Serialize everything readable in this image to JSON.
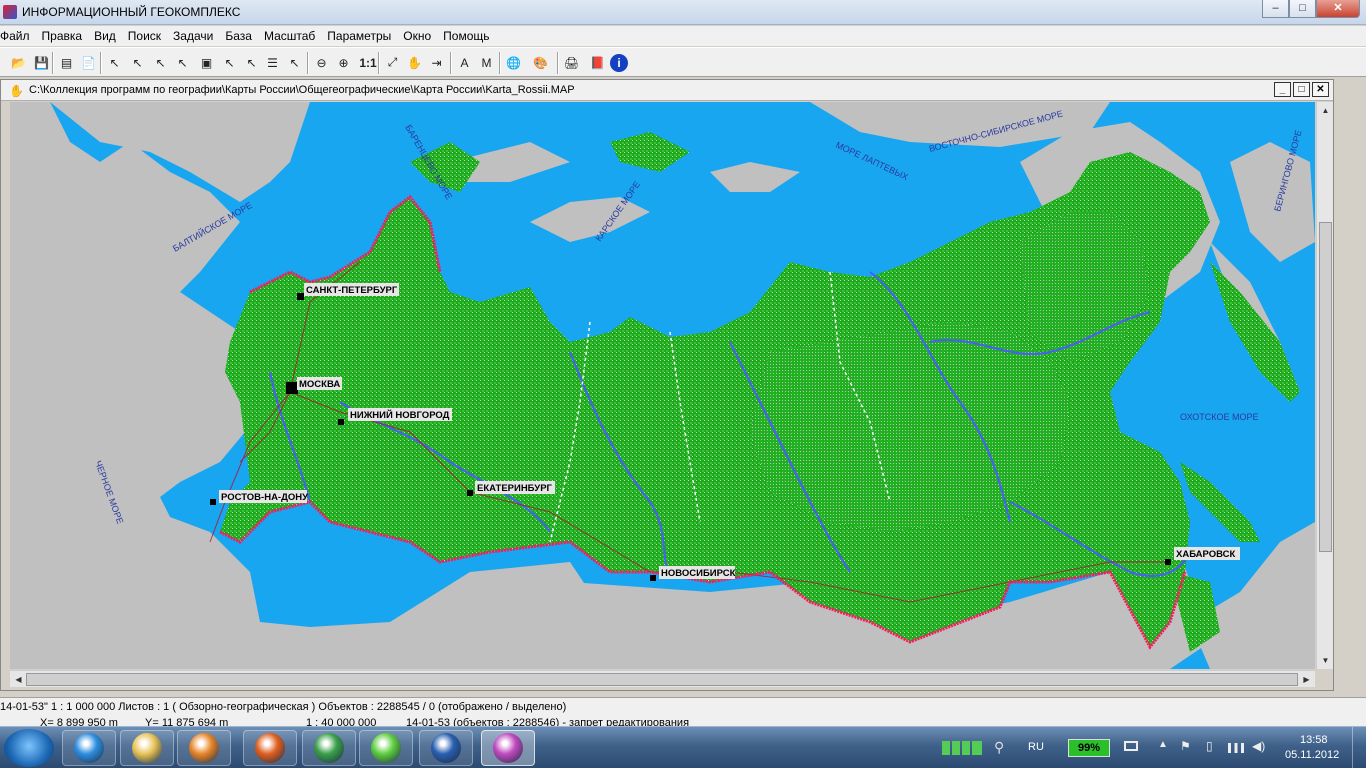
{
  "app": {
    "title": "ИНФОРМАЦИОННЫЙ ГЕОКОМПЛЕКС",
    "window_buttons": {
      "minimize": "‒",
      "maximize": "□",
      "close": "✕"
    }
  },
  "menu": [
    "Файл",
    "Правка",
    "Вид",
    "Поиск",
    "Задачи",
    "База",
    "Масштаб",
    "Параметры",
    "Окно",
    "Помощь"
  ],
  "toolbar": {
    "buttons": [
      {
        "name": "open-icon",
        "glyph": "📂"
      },
      {
        "name": "save-icon",
        "glyph": "💾"
      },
      {
        "name": "layers-icon",
        "glyph": "▤"
      },
      {
        "name": "document-icon",
        "glyph": "📄"
      },
      {
        "name": "select-object-icon",
        "glyph": "↖"
      },
      {
        "name": "select-area-icon",
        "glyph": "↖"
      },
      {
        "name": "select-multi-icon",
        "glyph": "↖"
      },
      {
        "name": "select-all-icon",
        "glyph": "↖"
      },
      {
        "name": "frame-select-icon",
        "glyph": "▣"
      },
      {
        "name": "pointer-select-icon",
        "glyph": "↖"
      },
      {
        "name": "pointer-query-icon",
        "glyph": "↖"
      },
      {
        "name": "list-icon",
        "glyph": "☰"
      },
      {
        "name": "clear-select-icon",
        "glyph": "↖"
      },
      {
        "name": "zoom-out-icon",
        "glyph": "⊖"
      },
      {
        "name": "zoom-in-icon",
        "glyph": "⊕"
      },
      {
        "name": "zoom-1to1-icon",
        "glyph": "1:1"
      },
      {
        "name": "fit-icon",
        "glyph": "⤢"
      },
      {
        "name": "pan-hand-icon",
        "glyph": "✋"
      },
      {
        "name": "move-icon",
        "glyph": "⇥"
      },
      {
        "name": "text-label-icon",
        "glyph": "A"
      },
      {
        "name": "label-mode-icon",
        "glyph": "M"
      },
      {
        "name": "globe-icon",
        "glyph": "🌐"
      },
      {
        "name": "palette-icon",
        "glyph": "🎨"
      },
      {
        "name": "print-icon",
        "glyph": "🖨"
      },
      {
        "name": "book-icon",
        "glyph": "📕"
      },
      {
        "name": "info-icon",
        "glyph": "i"
      }
    ],
    "scale_label": "1:1"
  },
  "map_window": {
    "path": "C:\\Коллекция программ по географии\\Карты России\\Общегеографические\\Карта России\\Karta_Rossii.MAP",
    "buttons": {
      "minimize": "_",
      "maximize": "□",
      "close": "✕"
    }
  },
  "map": {
    "colors": {
      "sea": "#19a6f0",
      "land_foreign": "#c0c0c0",
      "forest": "#1aaa1a",
      "forest_light": "#4cc84c",
      "border": "#ff1560",
      "rivers": "#4a5cff",
      "roads": "#b01030"
    },
    "cities": [
      {
        "name": "САНКТ-ПЕТЕРБУРГ",
        "id": "city-saint-petersburg"
      },
      {
        "name": "МОСКВА",
        "id": "city-moscow"
      },
      {
        "name": "НИЖНИЙ НОВГОРОД",
        "id": "city-nizhny-novgorod"
      },
      {
        "name": "РОСТОВ-НА-ДОНУ",
        "id": "city-rostov"
      },
      {
        "name": "ЕКАТЕРИНБУРГ",
        "id": "city-yekaterinburg"
      },
      {
        "name": "НОВОСИБИРСК",
        "id": "city-novosibirsk"
      },
      {
        "name": "ХАБАРОВСК",
        "id": "city-khabarovsk"
      }
    ],
    "seas": [
      {
        "name": "БАЛТИЙСКОЕ МОРЕ",
        "id": "sea-baltic"
      },
      {
        "name": "БАРЕНЦЕВО МОРЕ",
        "id": "sea-barents"
      },
      {
        "name": "КАРСКОЕ МОРЕ",
        "id": "sea-kara"
      },
      {
        "name": "МОРЕ ЛАПТЕВЫХ",
        "id": "sea-laptev"
      },
      {
        "name": "ВОСТОЧНО-СИБИРСКОЕ МОРЕ",
        "id": "sea-east-siberian"
      },
      {
        "name": "БЕРИНГОВО МОРЕ",
        "id": "sea-bering"
      },
      {
        "name": "ОХОТСКОЕ МОРЕ",
        "id": "sea-okhotsk"
      },
      {
        "name": "ЧЕРНОЕ МОРЕ",
        "id": "sea-black"
      }
    ]
  },
  "status": {
    "line1": "14-01-53\"  1 : 1 000 000   Листов : 1    ( Обзорно-географическая )  Объектов : 2288545 / 0 (отображено / выделено)",
    "x_coord": "X=   8 899 950  m",
    "y_coord": "Y=  11 875 694  m",
    "scale": "1 : 40 000 000",
    "objects": "14-01-53    (объектов : 2288546) - запрет редактирования"
  },
  "taskbar": {
    "apps": [
      {
        "name": "internet-explorer-icon",
        "color": "#2e8fe0"
      },
      {
        "name": "file-explorer-icon",
        "color": "#e8c45a"
      },
      {
        "name": "media-player-icon",
        "color": "#e8862a"
      },
      {
        "name": "firefox-icon",
        "color": "#e06020"
      },
      {
        "name": "chrome-icon",
        "color": "#3aa04a"
      },
      {
        "name": "icq-icon",
        "color": "#5fcf3f"
      },
      {
        "name": "word-icon",
        "color": "#2a5fb0"
      },
      {
        "name": "geocomplex-icon",
        "color": "#c04ac0"
      }
    ],
    "language": "RU",
    "battery": "99%",
    "time": "13:58",
    "date": "05.11.2012"
  }
}
